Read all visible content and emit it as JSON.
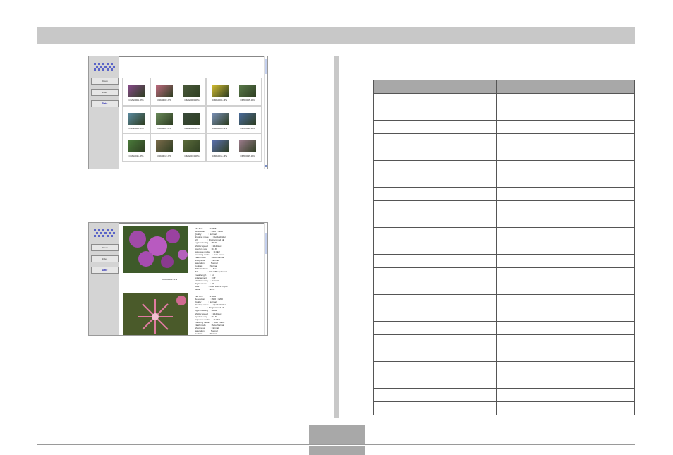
{
  "nav": {
    "back_label": "Album",
    "album_label": "Index",
    "date_label": "Date"
  },
  "grid": {
    "thumbnails": [
      {
        "filename": "CIMG0001.JPG",
        "color": "#8a4a8c"
      },
      {
        "filename": "CIMG0002.JPG",
        "color": "#c06a80"
      },
      {
        "filename": "CIMG0003.JPG",
        "color": "#4a5a3a"
      },
      {
        "filename": "CIMG0004.JPG",
        "color": "#d8c030"
      },
      {
        "filename": "CIMG0005.JPG",
        "color": "#5a7a4a"
      },
      {
        "filename": "CIMG0006.JPG",
        "color": "#5a8aa0"
      },
      {
        "filename": "CIMG0007.JPG",
        "color": "#6a8a5a"
      },
      {
        "filename": "CIMG0008.JPG",
        "color": "#3a4a3a"
      },
      {
        "filename": "CIMG0009.JPG",
        "color": "#7a90b8"
      },
      {
        "filename": "CIMG0010.JPG",
        "color": "#4a6a9a"
      },
      {
        "filename": "CIMG0011.JPG",
        "color": "#4a7a3a"
      },
      {
        "filename": "CIMG0012.JPG",
        "color": "#7a6a4a"
      },
      {
        "filename": "CIMG0013.JPG",
        "color": "#5a6a3a"
      },
      {
        "filename": "CIMG0014.JPG",
        "color": "#5a70b0"
      },
      {
        "filename": "CIMG0015.JPG",
        "color": "#9a7a8a"
      }
    ]
  },
  "detail": {
    "photo1_caption": "CIMG0001.JPG",
    "photo1_text": "File Size          : 270KB\nResolution         : 1600 x 1200\nQuality            : Normal\nshooting mode      : Quick shutter\nEV                 : Programmed AE\nLight metering     : Multi\nShutter speed      : 1/125sec\nAperture stop      : F2.8\nExposure mode      : 0.0EV\nFocusing mode      : Auto Focus\nFlash mode         : Auto/Normal\nSharpness          : Normal\nSaturation         : Normal\nContrast           : Normal\nWhite balance      : Auto\nISO                : ISO 125 equivalent\nFocal length       : 5.8\nEnlargement        : Off\nFlash intensity    : Normal\nDigital zoom       : Off\nDate               : 2006/ 1/16 2:37 pm\nModel              : EX-Z",
    "photo2_text": "File Size          : 1.5MB\nResolution         : 1600 x 1200\nQuality            : Normal\nshooting mode      : Quick shutter\nEV                 : Programmed AE\nLight metering     : Multi\nShutter speed      : 1/125sec\nAperture stop      : F2.8\nExposure mode      : 0.0EV\nFocusing mode      : Auto Focus\nFlash mode         : Auto/Normal\nSharpness          : Normal\nSaturation         : Normal\nContrast           : Normal\nWhite balance      : Auto\nISO                : ISO 125 equivalent"
  },
  "table": {
    "row_count": 24
  },
  "colors": {
    "bar": "#c8c8c8",
    "table_header": "#a8a8a8",
    "sidebar": "#d4d4d4"
  }
}
